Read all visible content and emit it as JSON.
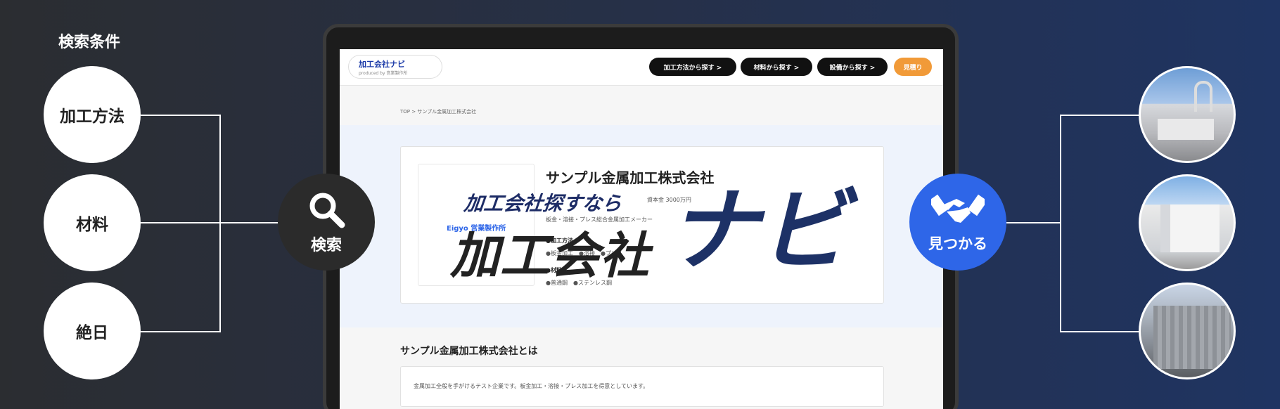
{
  "criteria": {
    "title": "検索条件",
    "items": [
      "加工方法",
      "材料",
      "絶日"
    ]
  },
  "search": {
    "label": "検索",
    "icon": "search-icon"
  },
  "found": {
    "label": "見つかる",
    "icon": "handshake-icon"
  },
  "site": {
    "logo_title": "加工会社ナビ",
    "logo_sub": "produced by 営業製作所",
    "nav": [
      "加工方法から探す >",
      "材料から探す >",
      "設備から探す >"
    ],
    "estimate": "見積り",
    "breadcrumb": "TOP  >  サンプル金属加工株式会社",
    "company_name": "サンプル金属加工株式会社",
    "capital": "資本金 3000万円",
    "business": "板金・溶接・プレス総合金属加工メーカー",
    "card_logo": "Eigyo 営業製作所",
    "spec_processing": "●加工方法",
    "spec_processing_values": "●板金加工　●溶接　●プレス",
    "spec_material": "●材料",
    "spec_material_values": "●普通鋼　●ステンレス鋼",
    "section_title": "サンプル金属加工株式会社とは",
    "description": "金属加工全般を手がけるテスト企業です。板金加工・溶接・プレス加工を得意としています。"
  },
  "overlay": {
    "tagline": "加工会社探すなら",
    "main": "加工会社",
    "navi": "ナビ"
  },
  "colors": {
    "accent_blue": "#2e66e8",
    "navy": "#1d3166",
    "estimate_orange": "#f19a38"
  }
}
